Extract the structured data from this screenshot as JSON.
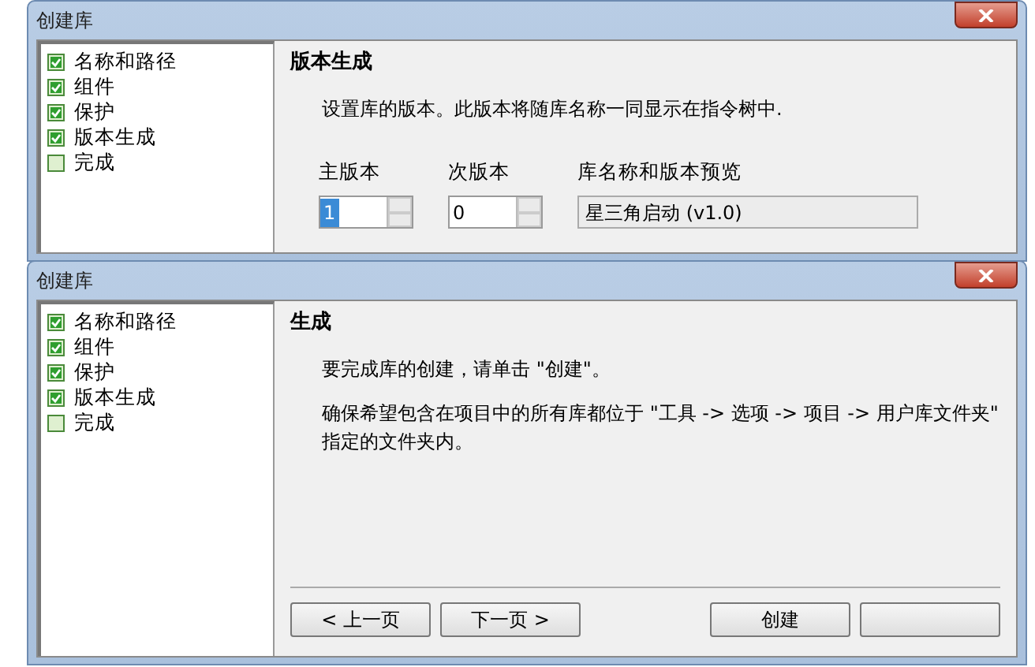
{
  "windows": [
    {
      "title": "创建库",
      "steps": [
        {
          "label": "名称和路径",
          "checked": true
        },
        {
          "label": "组件",
          "checked": true
        },
        {
          "label": "保护",
          "checked": true
        },
        {
          "label": "版本生成",
          "checked": true
        },
        {
          "label": "完成",
          "checked": false
        }
      ],
      "heading": "版本生成",
      "paragraphs": [
        "设置库的版本。此版本将随库名称一同显示在指令树中."
      ],
      "fields": [
        {
          "kind": "spinner",
          "label": "主版本",
          "value": "1",
          "selected": true
        },
        {
          "kind": "spinner",
          "label": "次版本",
          "value": "0",
          "selected": false
        },
        {
          "kind": "readonly",
          "label": "库名称和版本预览",
          "value": "星三角启动 (v1.0)"
        }
      ]
    },
    {
      "title": "创建库",
      "steps": [
        {
          "label": "名称和路径",
          "checked": true
        },
        {
          "label": "组件",
          "checked": true
        },
        {
          "label": "保护",
          "checked": true
        },
        {
          "label": "版本生成",
          "checked": true
        },
        {
          "label": "完成",
          "checked": false
        }
      ],
      "heading": "生成",
      "paragraphs": [
        "要完成库的创建，请单击 \"创建\"。",
        "确保希望包含在项目中的所有库都位于 \"工具 -> 选项 -> 项目 -> 用户库文件夹\" 指定的文件夹内。"
      ],
      "buttons": [
        {
          "label": "< 上一页"
        },
        {
          "label": "下一页 >"
        },
        {
          "label": "创建"
        }
      ]
    }
  ]
}
